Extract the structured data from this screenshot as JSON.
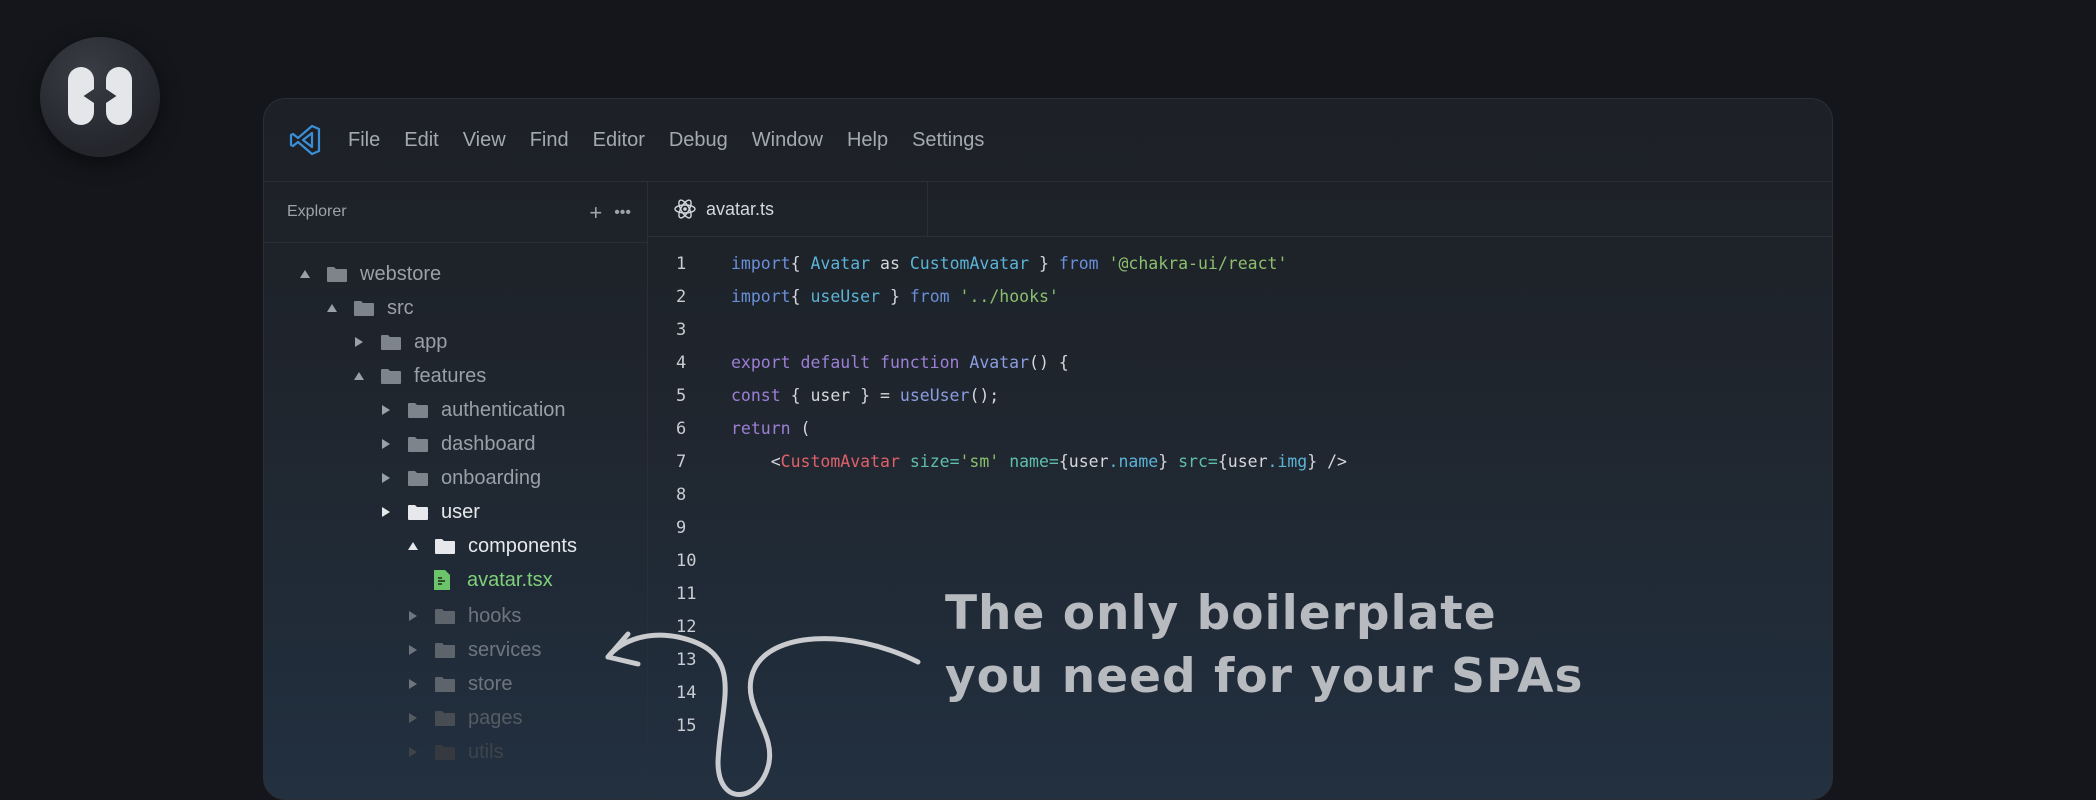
{
  "menu": [
    "File",
    "Edit",
    "View",
    "Find",
    "Editor",
    "Debug",
    "Window",
    "Help",
    "Settings"
  ],
  "explorer": {
    "title": "Explorer",
    "tree": [
      {
        "label": "webstore",
        "depth": 0,
        "state": "open",
        "tone": "normal"
      },
      {
        "label": "src",
        "depth": 1,
        "state": "open",
        "tone": "normal"
      },
      {
        "label": "app",
        "depth": 2,
        "state": "closed",
        "tone": "normal"
      },
      {
        "label": "features",
        "depth": 2,
        "state": "open",
        "tone": "normal"
      },
      {
        "label": "authentication",
        "depth": 3,
        "state": "closed",
        "tone": "normal"
      },
      {
        "label": "dashboard",
        "depth": 3,
        "state": "closed",
        "tone": "normal"
      },
      {
        "label": "onboarding",
        "depth": 3,
        "state": "closed",
        "tone": "normal"
      },
      {
        "label": "user",
        "depth": 3,
        "state": "closed",
        "tone": "bright"
      },
      {
        "label": "components",
        "depth": 4,
        "state": "open",
        "tone": "bright"
      },
      {
        "label": "avatar.tsx",
        "depth": 5,
        "state": "file",
        "tone": "green"
      },
      {
        "label": "hooks",
        "depth": 4,
        "state": "closed",
        "tone": "dim"
      },
      {
        "label": "services",
        "depth": 4,
        "state": "closed",
        "tone": "dim"
      },
      {
        "label": "store",
        "depth": 4,
        "state": "closed",
        "tone": "dim"
      },
      {
        "label": "pages",
        "depth": 4,
        "state": "closed",
        "tone": "dimmer"
      },
      {
        "label": "utils",
        "depth": 4,
        "state": "closed",
        "tone": "dimmest"
      }
    ]
  },
  "editor": {
    "tab_label": "avatar.ts",
    "line_numbers": [
      "1",
      "2",
      "3",
      "4",
      "5",
      "6",
      "7",
      "8",
      "9",
      "10",
      "11",
      "12",
      "13",
      "14",
      "15"
    ],
    "code": [
      [
        [
          "kw2",
          "import"
        ],
        [
          "",
          "{ "
        ],
        [
          "id",
          "Avatar"
        ],
        [
          "",
          " as "
        ],
        [
          "id",
          "CustomAvatar"
        ],
        [
          "",
          " } "
        ],
        [
          "kw2",
          "from"
        ],
        [
          "",
          " "
        ],
        [
          "str",
          "'@chakra-ui/react'"
        ]
      ],
      [
        [
          "kw2",
          "import"
        ],
        [
          "",
          "{ "
        ],
        [
          "id",
          "useUser"
        ],
        [
          "",
          " } "
        ],
        [
          "kw2",
          "from"
        ],
        [
          "",
          " "
        ],
        [
          "str",
          "'../hooks'"
        ]
      ],
      [],
      [
        [
          "kw",
          "export default function"
        ],
        [
          "",
          " "
        ],
        [
          "fn",
          "Avatar"
        ],
        [
          "",
          "() {"
        ]
      ],
      [
        [
          "kw",
          "const"
        ],
        [
          "",
          " { user } = "
        ],
        [
          "fn",
          "useUser"
        ],
        [
          "",
          "();"
        ]
      ],
      [
        [
          "kw",
          "return"
        ],
        [
          "",
          " ("
        ]
      ],
      [
        [
          "",
          "    <"
        ],
        [
          "tag",
          "CustomAvatar"
        ],
        [
          "",
          " "
        ],
        [
          "attr",
          "size="
        ],
        [
          "str",
          "'sm'"
        ],
        [
          "",
          " "
        ],
        [
          "attr",
          "name="
        ],
        [
          "",
          "{user"
        ],
        [
          "id",
          ".name"
        ],
        [
          "",
          "} "
        ],
        [
          "attr",
          "src="
        ],
        [
          "",
          "{user"
        ],
        [
          "id",
          ".img"
        ],
        [
          "",
          "} />"
        ]
      ],
      [],
      [],
      [],
      [],
      [],
      [],
      [],
      []
    ]
  },
  "annotation": {
    "line1": "The only boilerplate",
    "line2": "you need for your SPAs"
  },
  "colors": {
    "background": "#14161b",
    "accent_green": "#7fd07a",
    "keyword": "#9d7fd6",
    "string": "#8bbf6e",
    "tag": "#e0606a"
  }
}
